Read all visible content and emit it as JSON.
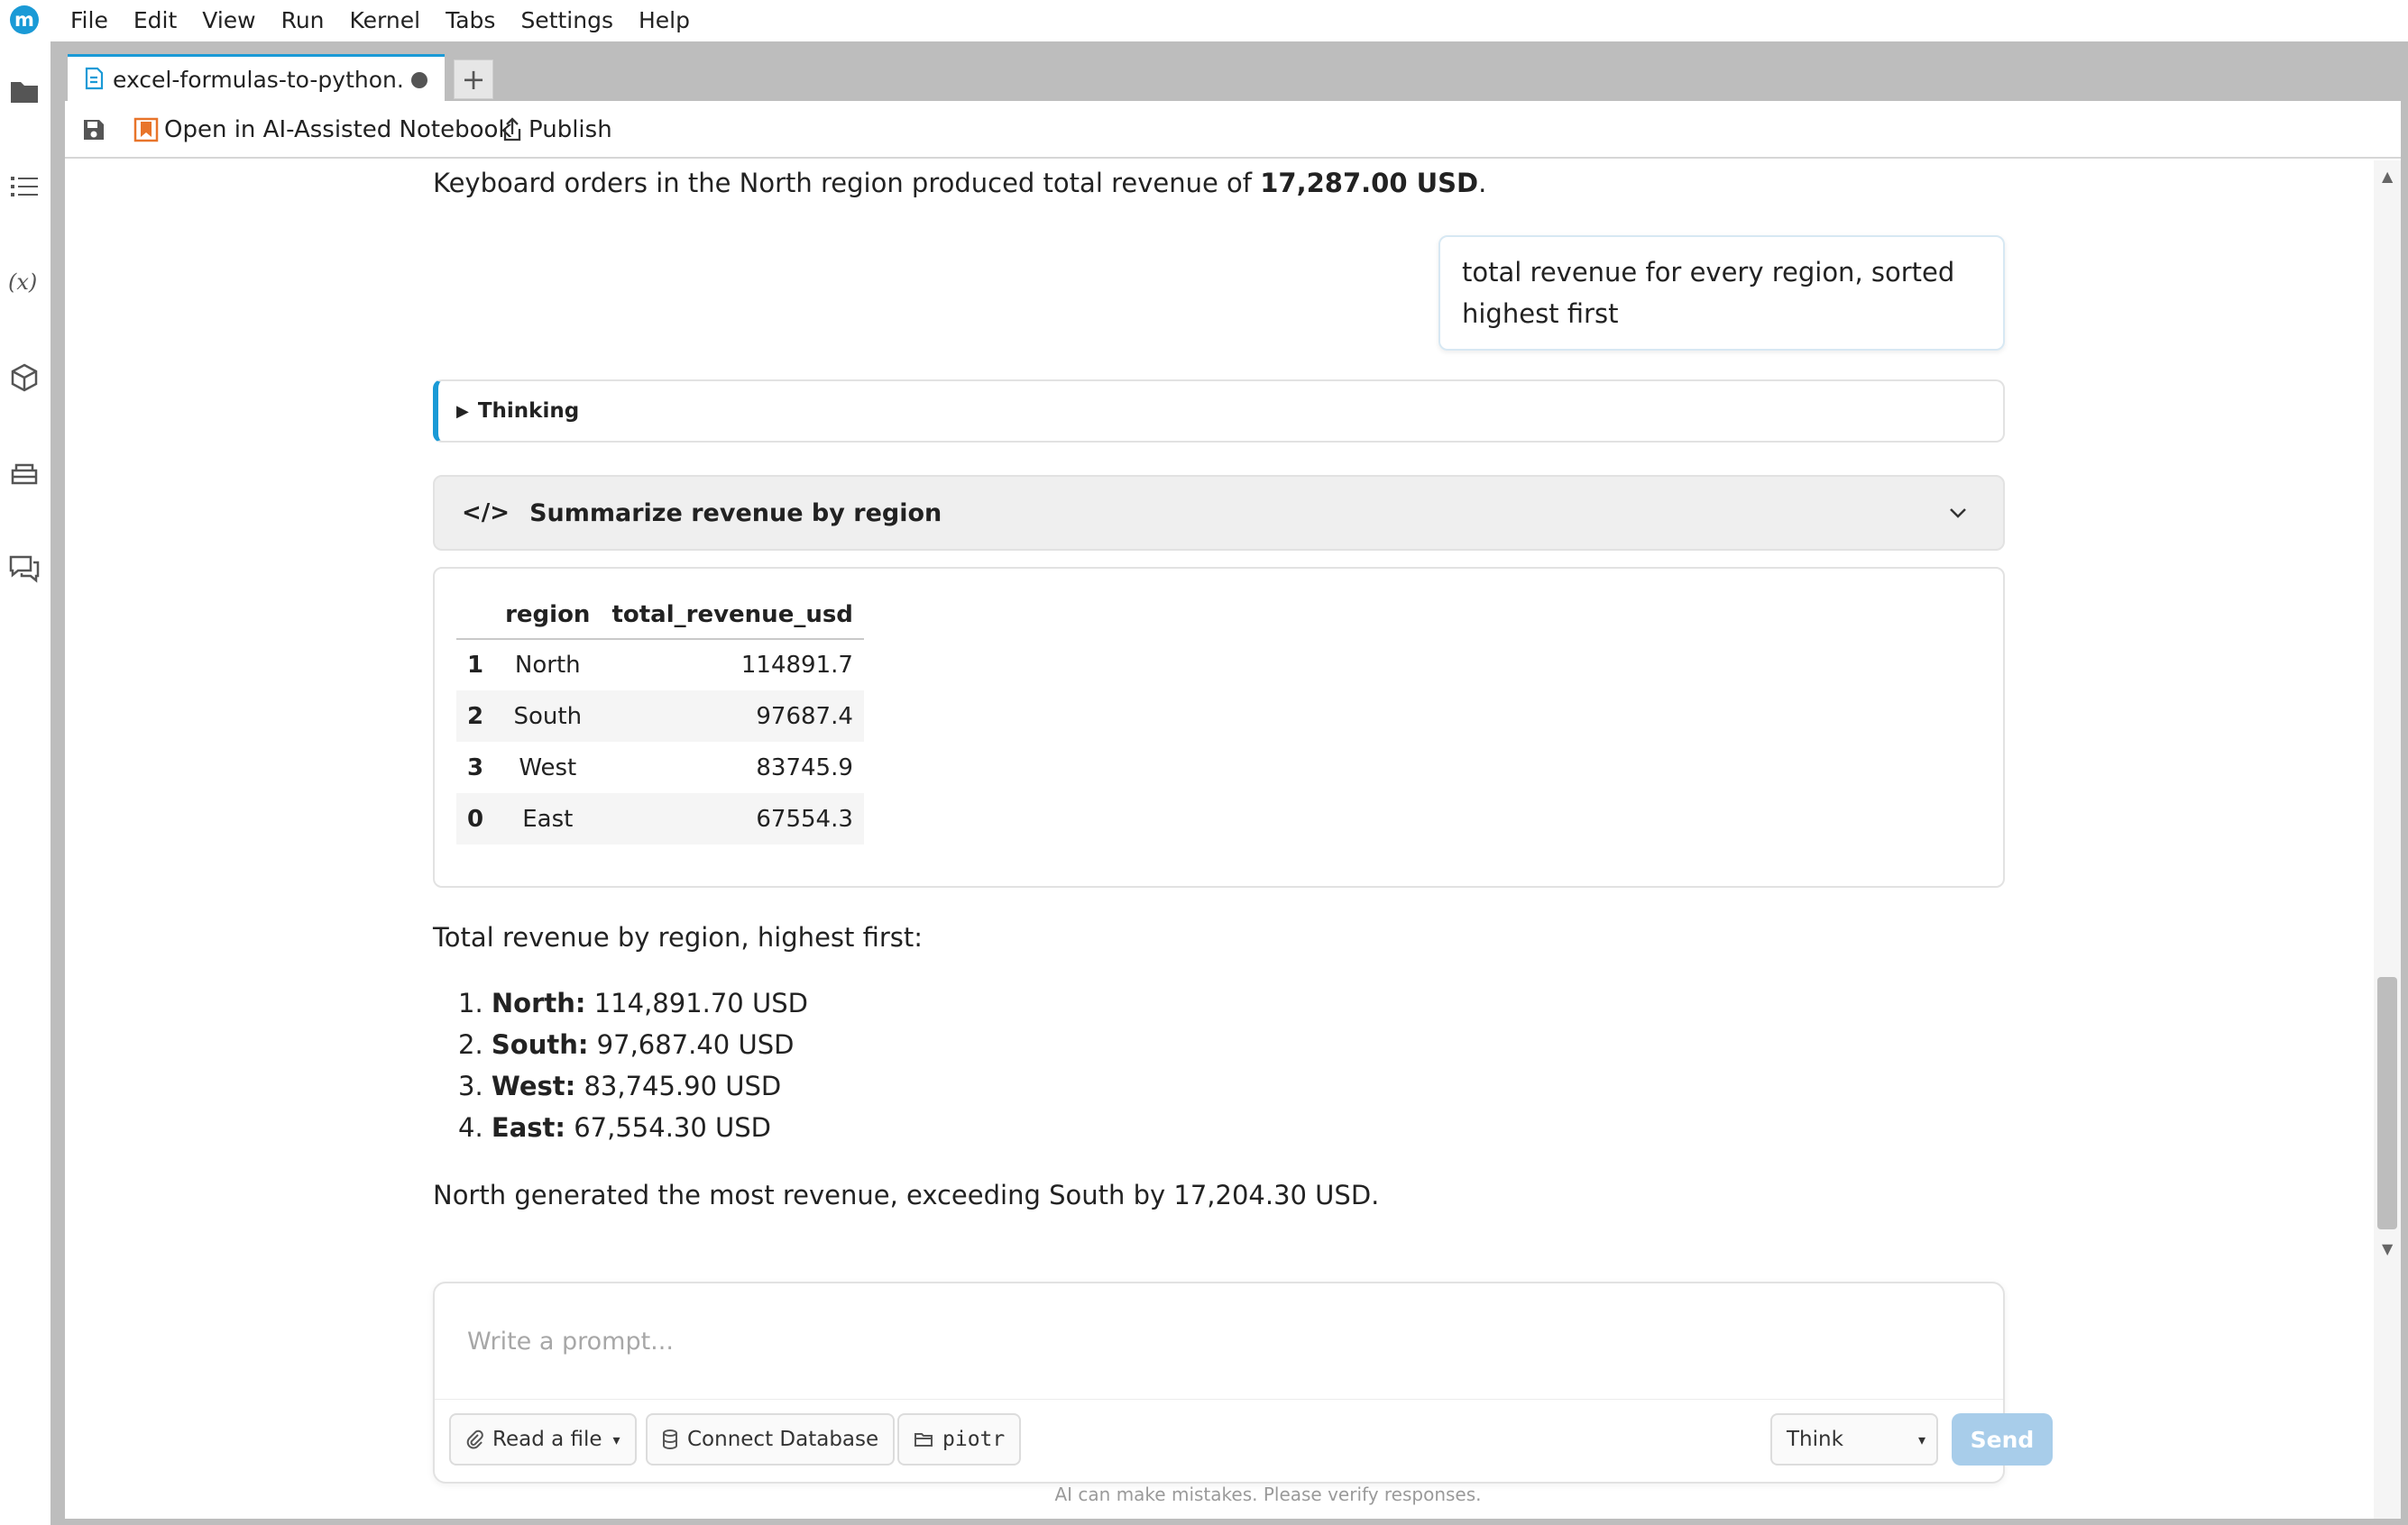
{
  "app": {
    "logo_letter": "m",
    "menu": [
      "File",
      "Edit",
      "View",
      "Run",
      "Kernel",
      "Tabs",
      "Settings",
      "Help"
    ]
  },
  "sidebar_icons": [
    "folder-icon",
    "list-icon",
    "variables-icon",
    "package-icon",
    "database-icon",
    "chat-icon"
  ],
  "tab": {
    "label": "excel-formulas-to-python.ipynb",
    "new_tab_symbol": "+"
  },
  "toolbar": {
    "open_ai_label": "Open in AI-Assisted Notebook",
    "publish_label": "Publish"
  },
  "chat": {
    "prev_answer": {
      "prefix": "Keyboard orders in the North region produced total revenue of ",
      "amount": "17,287.00 USD",
      "suffix": "."
    },
    "user_message": "total revenue for every region, sorted highest first",
    "thinking_label": "Thinking",
    "tool": {
      "icon": "</>",
      "label": "Summarize revenue by region"
    },
    "table": {
      "columns": [
        "",
        "region",
        "total_revenue_usd"
      ],
      "rows": [
        {
          "index": "1",
          "region": "North",
          "total": "114891.7"
        },
        {
          "index": "2",
          "region": "South",
          "total": "97687.4"
        },
        {
          "index": "3",
          "region": "West",
          "total": "83745.9"
        },
        {
          "index": "0",
          "region": "East",
          "total": "67554.3"
        }
      ]
    },
    "summary": {
      "heading": "Total revenue by region, highest first:",
      "items": [
        {
          "num": "1.",
          "region": "North:",
          "value": " 114,891.70 USD"
        },
        {
          "num": "2.",
          "region": "South:",
          "value": " 97,687.40 USD"
        },
        {
          "num": "3.",
          "region": "West:",
          "value": " 83,745.90 USD"
        },
        {
          "num": "4.",
          "region": "East:",
          "value": " 67,554.30 USD"
        }
      ],
      "conclusion": "North generated the most revenue, exceeding South by 17,204.30 USD."
    }
  },
  "prompt": {
    "placeholder": "Write a prompt...",
    "value": "",
    "read_file_label": "Read a file",
    "connect_db_label": "Connect Database",
    "user_label": "piotr",
    "mode_label": "Think",
    "send_label": "Send",
    "disclaimer": "AI can make mistakes. Please verify responses."
  },
  "colors": {
    "accent": "#1a9ad6",
    "send_disabled": "#a8cdea",
    "frame": "#bdbdbd"
  }
}
